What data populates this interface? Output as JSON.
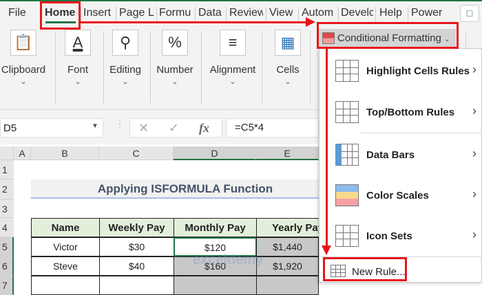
{
  "tabs": [
    "File",
    "Home",
    "Insert",
    "Page L",
    "Formu",
    "Data",
    "Review",
    "View",
    "Autom",
    "Develc",
    "Help",
    "Power"
  ],
  "ribbon": {
    "groups": [
      "Clipboard",
      "Font",
      "Editing",
      "Number",
      "Alignment",
      "Cells"
    ],
    "conditional_formatting": "Conditional Formatting"
  },
  "formula_bar": {
    "name_box": "D5",
    "formula": "=C5*4",
    "fx": "fx"
  },
  "sheet": {
    "columns": [
      "A",
      "B",
      "C",
      "D",
      "E"
    ],
    "rows": [
      "1",
      "2",
      "3",
      "4",
      "5",
      "6",
      "7"
    ],
    "title": "Applying ISFORMULA Function",
    "headers": [
      "Name",
      "Weekly Pay",
      "Monthly Pay",
      "Yearly Pay"
    ],
    "data": [
      [
        "Victor",
        "$30",
        "$120",
        "$1,440"
      ],
      [
        "Steve",
        "$40",
        "$160",
        "$1,920"
      ]
    ]
  },
  "menu": {
    "items": [
      {
        "label": "Highlight Cells Rules"
      },
      {
        "label": "Top/Bottom Rules"
      },
      {
        "label": "Data Bars"
      },
      {
        "label": "Color Scales"
      },
      {
        "label": "Icon Sets"
      }
    ],
    "new_rule": "New Rule..."
  },
  "watermark": "exceldemy",
  "colors": {
    "accent": "#217346",
    "annotation": "#e8141a"
  }
}
